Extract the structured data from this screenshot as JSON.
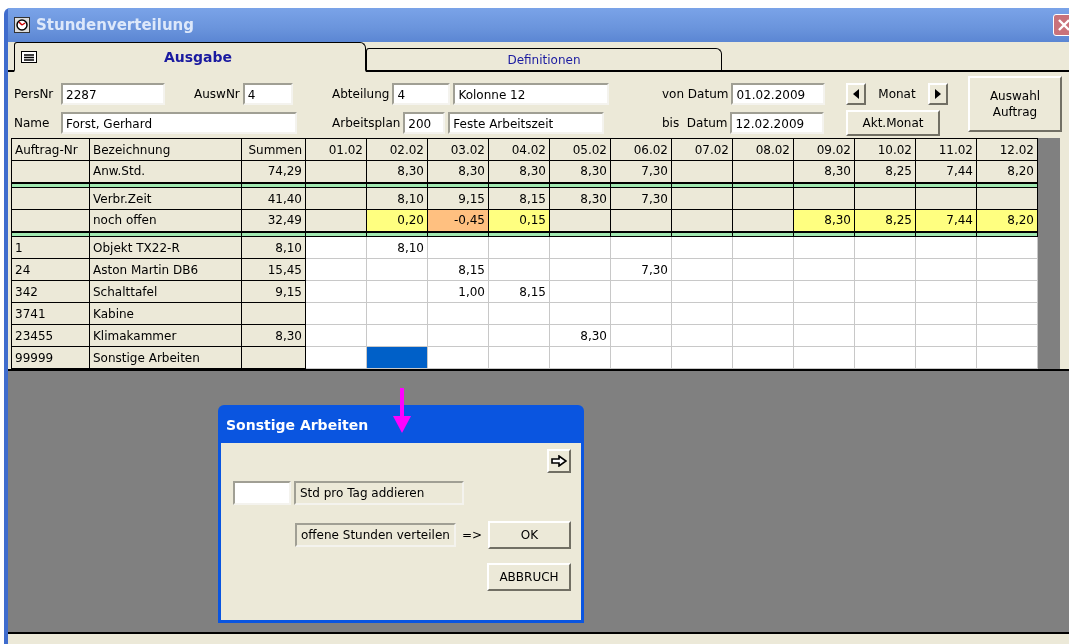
{
  "window": {
    "title": "Stundenverteilung"
  },
  "tabs": [
    {
      "label": "Ausgabe",
      "selected": true
    },
    {
      "label": "Definitionen",
      "selected": false
    }
  ],
  "form": {
    "persnr": {
      "label": "PersNr",
      "value": "2287"
    },
    "auswnr": {
      "label": "AuswNr",
      "value": "4"
    },
    "name": {
      "label": "Name",
      "value": "Forst, Gerhard"
    },
    "abteilung": {
      "label": "Abteilung",
      "value": "4",
      "text": "Kolonne 12"
    },
    "arbeitsplan": {
      "label": "Arbeitsplan",
      "value": "200",
      "text": "Feste Arbeitszeit"
    },
    "von_datum": {
      "label": "von Datum",
      "value": "01.02.2009"
    },
    "bis_datum": {
      "label": "bis  Datum",
      "value": "12.02.2009"
    },
    "monat_label": "Monat",
    "akt_monat_button": "Akt.Monat",
    "auswahl_button": "Auswahl Auftrag"
  },
  "table": {
    "columns": [
      "Auftrag-Nr",
      "Bezeichnung",
      "Summen",
      "01.02",
      "02.02",
      "03.02",
      "04.02",
      "05.02",
      "06.02",
      "07.02",
      "08.02",
      "09.02",
      "10.02",
      "11.02",
      "12.02"
    ],
    "rows": [
      {
        "kind": "summary",
        "separator_after": true,
        "cells": [
          {},
          {
            "text": "Anw.Std."
          },
          {
            "text": "74,29"
          },
          {},
          {
            "text": "8,30"
          },
          {
            "text": "8,30"
          },
          {
            "text": "8,30"
          },
          {
            "text": "8,30"
          },
          {
            "text": "7,30"
          },
          {},
          {},
          {
            "text": "8,30"
          },
          {
            "text": "8,25"
          },
          {
            "text": "7,44"
          },
          {
            "text": "8,20"
          }
        ]
      },
      {
        "kind": "summary",
        "separator_after": false,
        "cells": [
          {},
          {
            "text": "Verbr.Zeit"
          },
          {
            "text": "41,40"
          },
          {},
          {
            "text": "8,10"
          },
          {
            "text": "9,15"
          },
          {
            "text": "8,15"
          },
          {
            "text": "8,30"
          },
          {
            "text": "7,30"
          },
          {},
          {},
          {},
          {},
          {},
          {}
        ]
      },
      {
        "kind": "summary",
        "separator_after": true,
        "cells": [
          {},
          {
            "text": "noch offen"
          },
          {
            "text": "32,49"
          },
          {},
          {
            "text": "0,20",
            "color": "#ffff80"
          },
          {
            "text": "-0,45",
            "color": "#ffc080"
          },
          {
            "text": "0,15",
            "color": "#ffff80"
          },
          {},
          {},
          {},
          {},
          {
            "text": "8,30",
            "color": "#ffff80"
          },
          {
            "text": "8,25",
            "color": "#ffff80"
          },
          {
            "text": "7,44",
            "color": "#ffff80"
          },
          {
            "text": "8,20",
            "color": "#ffff80"
          }
        ]
      },
      {
        "kind": "order",
        "cells": [
          {
            "text": "1"
          },
          {
            "text": "Objekt TX22-R"
          },
          {
            "text": "8,10"
          },
          {
            "selected": false
          },
          {
            "text": "8,10",
            "selected": false
          },
          {
            "selected": false
          },
          {
            "selected": false
          },
          {
            "selected": false
          },
          {
            "selected": false
          },
          {
            "selected": false
          },
          {
            "selected": false
          },
          {
            "selected": false
          },
          {
            "selected": false
          },
          {
            "selected": false
          },
          {
            "selected": false
          }
        ]
      },
      {
        "kind": "order",
        "cells": [
          {
            "text": "24"
          },
          {
            "text": "Aston Martin DB6"
          },
          {
            "text": "15,45"
          },
          {
            "selected": false
          },
          {
            "selected": false
          },
          {
            "text": "8,15",
            "selected": false
          },
          {
            "selected": false
          },
          {
            "selected": false
          },
          {
            "text": "7,30",
            "selected": false
          },
          {
            "selected": false
          },
          {
            "selected": false
          },
          {
            "selected": false
          },
          {
            "selected": false
          },
          {
            "selected": false
          },
          {
            "selected": false
          }
        ]
      },
      {
        "kind": "order",
        "cells": [
          {
            "text": "342"
          },
          {
            "text": "Schalttafel"
          },
          {
            "text": "9,15"
          },
          {
            "selected": false
          },
          {
            "selected": false
          },
          {
            "text": "1,00",
            "selected": false
          },
          {
            "text": "8,15",
            "selected": false
          },
          {
            "selected": false
          },
          {
            "selected": false
          },
          {
            "selected": false
          },
          {
            "selected": false
          },
          {
            "selected": false
          },
          {
            "selected": false
          },
          {
            "selected": false
          },
          {
            "selected": false
          }
        ]
      },
      {
        "kind": "order",
        "cells": [
          {
            "text": "3741"
          },
          {
            "text": "Kabine"
          },
          {},
          {
            "selected": false
          },
          {
            "selected": false
          },
          {
            "selected": false
          },
          {
            "selected": false
          },
          {
            "selected": false
          },
          {
            "selected": false
          },
          {
            "selected": false
          },
          {
            "selected": false
          },
          {
            "selected": false
          },
          {
            "selected": false
          },
          {
            "selected": false
          },
          {
            "selected": false
          }
        ]
      },
      {
        "kind": "order",
        "cells": [
          {
            "text": "23455"
          },
          {
            "text": "Klimakammer"
          },
          {
            "text": "8,30"
          },
          {
            "selected": false
          },
          {
            "selected": false
          },
          {
            "selected": false
          },
          {
            "selected": false
          },
          {
            "text": "8,30",
            "selected": false
          },
          {
            "selected": false
          },
          {
            "selected": false
          },
          {
            "selected": false
          },
          {
            "selected": false
          },
          {
            "selected": false
          },
          {
            "selected": false
          },
          {
            "selected": false
          }
        ]
      },
      {
        "kind": "order",
        "cells": [
          {
            "text": "99999"
          },
          {
            "text": "Sonstige Arbeiten"
          },
          {},
          {
            "selected": false
          },
          {
            "selected": true
          },
          {
            "selected": false
          },
          {
            "selected": false
          },
          {
            "selected": false
          },
          {
            "selected": false
          },
          {
            "selected": false
          },
          {
            "selected": false
          },
          {
            "selected": false
          },
          {
            "selected": false
          },
          {
            "selected": false
          },
          {
            "selected": false
          }
        ]
      }
    ]
  },
  "dialog": {
    "title": "Sonstige Arbeiten",
    "add_label": "Std pro Tag addieren",
    "distribute_label": "offene Stunden verteilen",
    "arrow_text": "=>",
    "ok_button": "OK",
    "cancel_button": "ABBRUCH"
  }
}
